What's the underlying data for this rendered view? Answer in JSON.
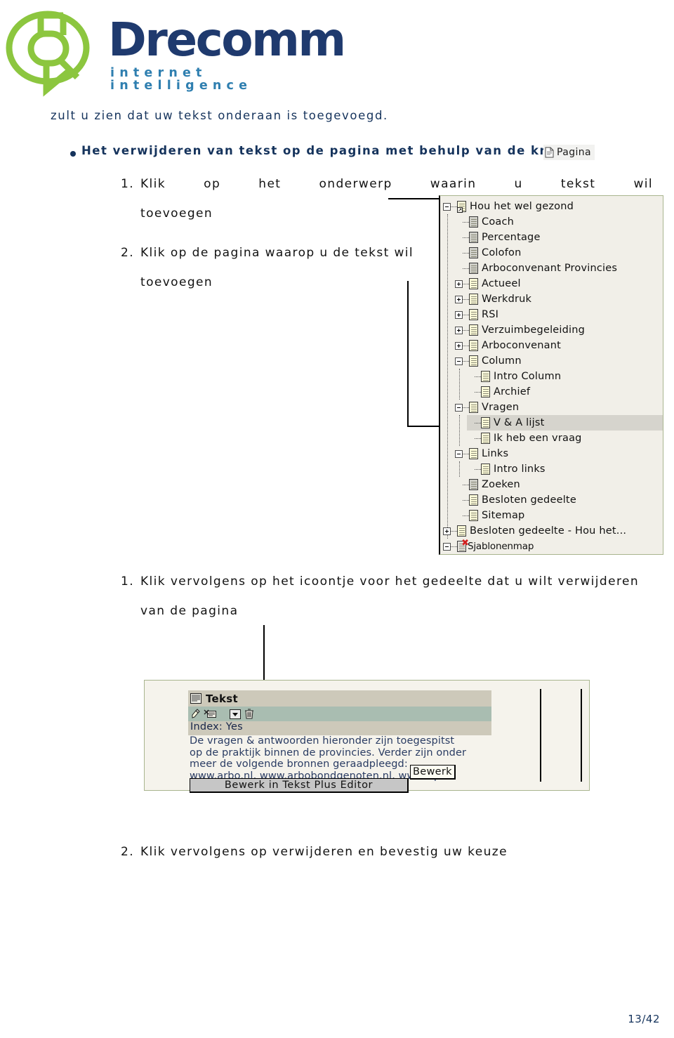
{
  "logo": {
    "wordmark": "Drecomm",
    "tagline": "internet intelligence",
    "mark_color": "#8cc63f",
    "word_color": "#1f3a6e",
    "tag_color": "#2f7fb0"
  },
  "content": {
    "intro_line": "zult u zien dat uw tekst onderaan is toegevoegd.",
    "bullet_heading": "Het verwijderen van tekst op de pagina met behulp van de knop",
    "pagina_chip_label": "Pagina",
    "steps": [
      {
        "num": "1.",
        "text": "Klik op het onderwerp waarin u tekst wil",
        "cont": "toevoegen"
      },
      {
        "num": "2.",
        "text": "Klik op de pagina waarop u de tekst wil",
        "cont": "toevoegen"
      },
      {
        "num": "1.",
        "text": "Klik vervolgens op het icoontje voor het gedeelte dat u wilt verwijderen",
        "cont": "van de pagina"
      },
      {
        "num": "2.",
        "text": "Klik vervolgens op verwijderen en bevestig uw keuze",
        "cont": ""
      }
    ]
  },
  "tree": {
    "nodes": [
      {
        "label": "Hou het wel gezond",
        "indent": 0,
        "expander": "minus",
        "icon": "page-shortcut",
        "selected": false
      },
      {
        "label": "Coach",
        "indent": 1,
        "expander": "none",
        "icon": "page-gray",
        "selected": false
      },
      {
        "label": "Percentage",
        "indent": 1,
        "expander": "none",
        "icon": "page-gray",
        "selected": false
      },
      {
        "label": "Colofon",
        "indent": 1,
        "expander": "none",
        "icon": "page-gray",
        "selected": false
      },
      {
        "label": "Arboconvenant Provincies",
        "indent": 1,
        "expander": "none",
        "icon": "page-gray",
        "selected": false
      },
      {
        "label": "Actueel",
        "indent": 1,
        "expander": "plus",
        "icon": "page-yellow",
        "selected": false
      },
      {
        "label": "Werkdruk",
        "indent": 1,
        "expander": "plus",
        "icon": "page-yellow",
        "selected": false
      },
      {
        "label": "RSI",
        "indent": 1,
        "expander": "plus",
        "icon": "page-yellow",
        "selected": false
      },
      {
        "label": "Verzuimbegeleiding",
        "indent": 1,
        "expander": "plus",
        "icon": "page-yellow",
        "selected": false
      },
      {
        "label": "Arboconvenant",
        "indent": 1,
        "expander": "plus",
        "icon": "page-yellow",
        "selected": false
      },
      {
        "label": "Column",
        "indent": 1,
        "expander": "minus",
        "icon": "page-yellow",
        "selected": false
      },
      {
        "label": "Intro Column",
        "indent": 2,
        "expander": "none",
        "icon": "page-yellow",
        "selected": false
      },
      {
        "label": "Archief",
        "indent": 2,
        "expander": "none",
        "icon": "page-yellow",
        "selected": false
      },
      {
        "label": "Vragen",
        "indent": 1,
        "expander": "minus",
        "icon": "page-yellow",
        "selected": false
      },
      {
        "label": "V & A lijst",
        "indent": 2,
        "expander": "none",
        "icon": "page-yellow",
        "selected": true
      },
      {
        "label": "Ik heb een vraag",
        "indent": 2,
        "expander": "none",
        "icon": "page-yellow",
        "selected": false
      },
      {
        "label": "Links",
        "indent": 1,
        "expander": "minus",
        "icon": "page-yellow",
        "selected": false
      },
      {
        "label": "Intro links",
        "indent": 2,
        "expander": "none",
        "icon": "page-yellow",
        "selected": false
      },
      {
        "label": "Zoeken",
        "indent": 1,
        "expander": "none",
        "icon": "page-gray",
        "selected": false
      },
      {
        "label": "Besloten gedeelte",
        "indent": 1,
        "expander": "none",
        "icon": "page-yellow",
        "selected": false
      },
      {
        "label": "Sitemap",
        "indent": 1,
        "expander": "none",
        "icon": "page-yellow",
        "selected": false
      },
      {
        "label": "Besloten gedeelte - Hou het...",
        "indent": 0,
        "expander": "plus",
        "icon": "page-yellow",
        "selected": false
      },
      {
        "label": "Sjablonenmap",
        "indent": 0,
        "expander": "minus",
        "icon": "page-deleted",
        "selected": false
      }
    ]
  },
  "tekst_panel": {
    "header_label": "Tekst",
    "header_icon": "text-block-icon",
    "toolbar_icons": [
      "pencil-icon",
      "edit-list-icon",
      "dropdown-arrow-icon",
      "trash-icon"
    ],
    "index_label": "Index: Yes",
    "body_text": "De vragen & antwoorden hieronder zijn toegespitst op de praktijk binnen de provincies. Verder zijn onder meer de volgende bronnen geraadpleegd: www.arbo.nl, www.arbobondgenoten.nl, www.tql.nl",
    "edit_button_label": "Bewerk in Tekst Plus Editor",
    "tooltip_label": "Bewerk"
  },
  "footer": {
    "page_number": "13/42"
  }
}
